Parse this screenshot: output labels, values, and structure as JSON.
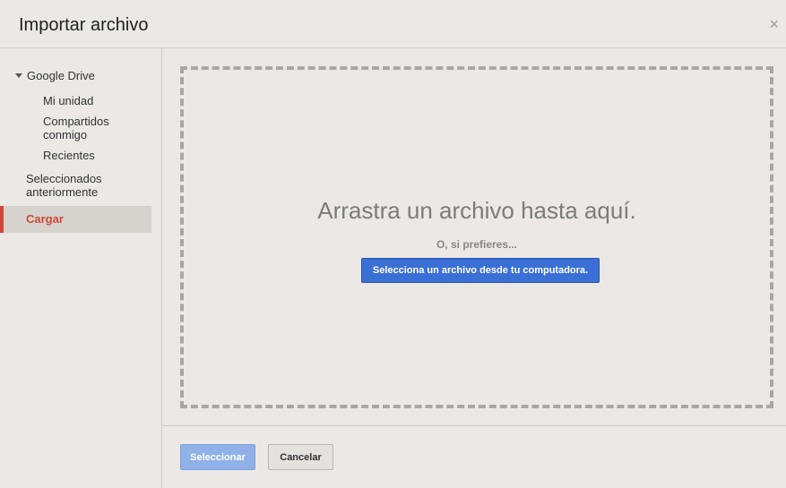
{
  "dialog": {
    "title": "Importar archivo",
    "close_glyph": "×"
  },
  "sidebar": {
    "google_drive": "Google Drive",
    "items": [
      {
        "label": "Mi unidad"
      },
      {
        "label": "Compartidos conmigo"
      },
      {
        "label": "Recientes"
      }
    ],
    "previously_selected": "Seleccionados anteriormente",
    "upload": "Cargar"
  },
  "dropzone": {
    "drag_text": "Arrastra un archivo hasta aquí.",
    "or_text": "O, si prefieres...",
    "select_button": "Selecciona un archivo desde tu computadora."
  },
  "footer": {
    "select_label": "Seleccionar",
    "cancel_label": "Cancelar"
  },
  "colors": {
    "accent_red": "#d14836",
    "primary_blue": "#3a6fd6",
    "disabled_blue": "#8fb1e8"
  },
  "icons": {
    "close": "close-icon",
    "caret": "caret-down-icon"
  }
}
